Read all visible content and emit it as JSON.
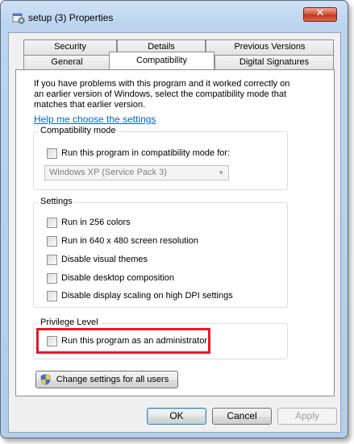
{
  "window": {
    "title": "setup (3) Properties",
    "close_glyph": "✕"
  },
  "tabs": {
    "row1": [
      "Security",
      "Details",
      "Previous Versions"
    ],
    "row2": [
      "General",
      "Compatibility",
      "Digital Signatures"
    ],
    "active": "Compatibility"
  },
  "intro": {
    "text": "If you have problems with this program and it worked correctly on an earlier version of Windows, select the compatibility mode that matches that earlier version.",
    "help_link": "Help me choose the settings"
  },
  "compat_mode": {
    "group_label": "Compatibility mode",
    "checkbox_label": "Run this program in compatibility mode for:",
    "selected_os": "Windows XP (Service Pack 3)"
  },
  "settings": {
    "group_label": "Settings",
    "items": [
      "Run in 256 colors",
      "Run in 640 x 480 screen resolution",
      "Disable visual themes",
      "Disable desktop composition",
      "Disable display scaling on high DPI settings"
    ]
  },
  "privilege": {
    "group_label": "Privilege Level",
    "checkbox_label": "Run this program as an administrator"
  },
  "change_settings_button": "Change settings for all users",
  "footer": {
    "ok": "OK",
    "cancel": "Cancel",
    "apply": "Apply"
  },
  "colors": {
    "highlight": "#e01b2b",
    "link": "#0066cc",
    "close_button": "#c7351e"
  },
  "icons": {
    "title": "program-properties-icon",
    "close": "close-icon",
    "dropdown": "chevron-down-icon",
    "uac": "uac-shield-icon"
  }
}
